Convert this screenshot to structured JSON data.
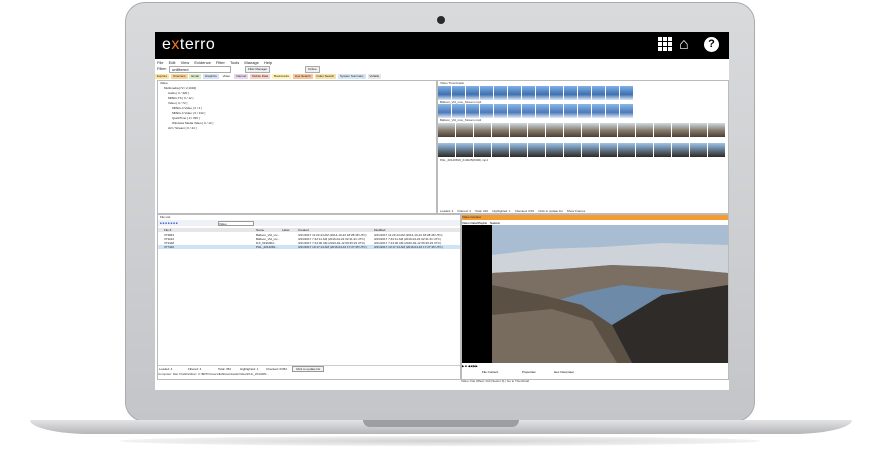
{
  "brand": {
    "logo_pre": "e",
    "logo_x": "x",
    "logo_post": "terro",
    "accent": "#f47a20"
  },
  "topbar_icons": [
    "apps-grid-icon",
    "home-icon",
    "help-icon"
  ],
  "menubar": [
    "File",
    "Edit",
    "View",
    "Evidence",
    "Filter",
    "Tools",
    "Manage",
    "Help"
  ],
  "toolbar": {
    "filter_label": "Filter:",
    "filter_value": "unfiltered",
    "filter_manager": "Filter Manager",
    "online": "Online"
  },
  "tabs": [
    "Explore",
    "Overview",
    "Email",
    "Graphics",
    "Video",
    "Internet",
    "Mobile Data",
    "Bookmarks",
    "Live Search",
    "Index Search",
    "System Summary",
    "Volatile"
  ],
  "tree": {
    "title": "Video",
    "items": [
      "Multimedia [72 / 2,1094]",
      "Audio [ 0 / 320 ]",
      "MPEG-TS [ 0 / 12 ]",
      "Video [ 0 / 72 ]",
      "MPEG-4 Video [ 0 / 4 ]",
      "MPEG-4 Video [ 0 / 132 ]",
      "QuickTime [ 0 / 336 ]",
      "Windows Media Video [ 0 / 12 ]",
      "AVI / Stream [ 0 / 44 ]"
    ]
  },
  "thumbs": {
    "title": "Video Thumbnails",
    "strip_labels": [
      "Balloon_Vid_Live_Stream.mp4",
      "Balloon_Vid_Live_Stream.mp4",
      "",
      "PHL_20140816_014025(0000).mp4"
    ],
    "status": [
      "Loaded: 4",
      "Filtered: 4",
      "Total: 220",
      "Highlighted: 1",
      "Checked: 0/33",
      "Click to update list",
      "Show Frames"
    ]
  },
  "files": {
    "title": "File List",
    "quick_filter": "Video",
    "columns": [
      "File #",
      "Name",
      "Label",
      "Created",
      "Modified"
    ],
    "rows": [
      [
        "373843",
        "Balloon_Vid_Liv...",
        "",
        "3/21/2017 11:23:44 AM (2014-10-22 18:28:48 UTC)",
        "3/21/2017 11:23:44 AM (2014-10-22 18:28:48 UTC)"
      ],
      [
        "373222",
        "Balloon_Vid_Liv...",
        "",
        "3/23/2017 7:42:11 AM (2016-04-22 02:31:41 UTC)",
        "3/23/2017 7:42:11 AM (2016-04-22 02:31:41 UTC)"
      ],
      [
        "373448",
        "DJI_0199004...",
        "",
        "3/21/2017 7:24:00 AM (2016-04-12 09:36:23 UTC)",
        "3/21/2017 7:24:00 AM (2016-04-12 09:36:23 UTC)"
      ],
      [
        "377440",
        "PHL_2014081...",
        "",
        "3/21/2017 10:17:13 AM (2016-04-16 17:27:35 UTC)",
        "3/21/2017 10:17:13 AM (2016-04-16 17:27:35 UTC)"
      ]
    ],
    "status": [
      "Loaded: 4",
      "Filtered: 4",
      "Total: 352",
      "Highlighted: 1",
      "Checked: 0/352",
      "Click to update list"
    ],
    "path": "Computer: Diet Xtra\\Partition: C:\\$RTF\\Users\\Ed\\Downloads\\Video\\PHL_2014081..."
  },
  "video": {
    "header": "Video Content",
    "tabs": [
      "Video Data/Playlist",
      "Natural"
    ],
    "controls": "▶ ■ ◀◀ ▶▶",
    "bottom_tabs": [
      "File Content",
      "Properties",
      "Hex Interpreter"
    ],
    "status": "Video: File Offset: 0x0 (Sector 0) | Go to Thumbnail"
  }
}
